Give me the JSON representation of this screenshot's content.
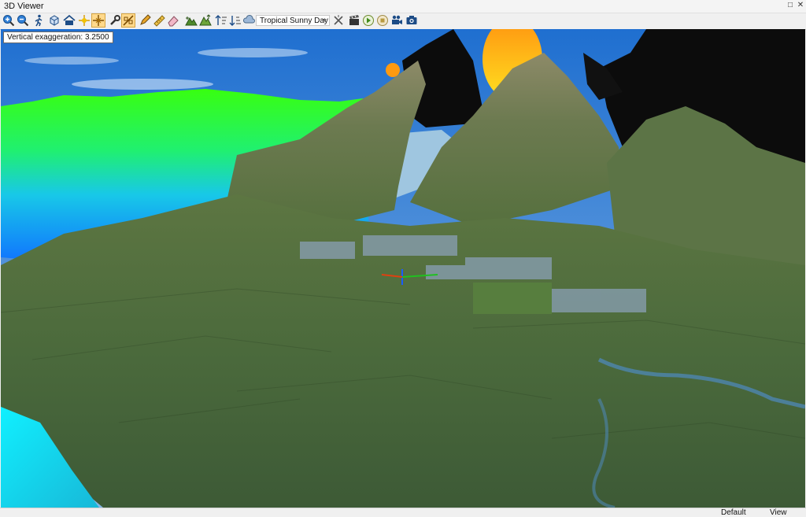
{
  "window": {
    "title": "3D Viewer"
  },
  "toolbar": {
    "tools": [
      {
        "name": "zoom-in-icon",
        "active": false
      },
      {
        "name": "zoom-out-icon",
        "active": false
      },
      {
        "name": "walk-icon",
        "active": false
      },
      {
        "name": "cube-view-icon",
        "active": false
      },
      {
        "name": "home-icon",
        "active": false
      },
      {
        "name": "sun-icon",
        "active": false
      },
      {
        "name": "crosshair-icon",
        "active": true
      },
      {
        "name": "wrench-icon",
        "active": false
      },
      {
        "name": "pan-icon",
        "active": true
      },
      {
        "name": "pencil-icon",
        "active": false
      },
      {
        "name": "ruler-icon",
        "active": false
      },
      {
        "name": "eraser-icon",
        "active": false
      },
      {
        "name": "terrain-icon",
        "active": false
      },
      {
        "name": "terrain-alt-icon",
        "active": false
      },
      {
        "name": "sort-up-icon",
        "active": false
      },
      {
        "name": "sort-down-icon",
        "active": false
      },
      {
        "name": "weather-icon",
        "active": false
      },
      {
        "name": "clear-icon",
        "active": false
      },
      {
        "name": "clapper-icon",
        "active": false
      },
      {
        "name": "play-icon",
        "active": false
      },
      {
        "name": "stop-icon",
        "active": false
      },
      {
        "name": "video-camera-icon",
        "active": false
      },
      {
        "name": "camera-icon",
        "active": false
      }
    ],
    "sky_preset": "Tropical Sunny Day"
  },
  "viewport": {
    "vertical_exaggeration_label": "Vertical exaggeration: 3.2500"
  },
  "status": {
    "default_label": "Default",
    "view_label": "View"
  },
  "colors": {
    "active_tool_bg": "#ffd98c",
    "terrain_green": "#4f6b3a",
    "sky_blue": "#3a86d8",
    "point_cloud_green": "#38ff10",
    "point_cloud_cyan": "#18d8f0",
    "sun_orange": "#ffa010"
  }
}
